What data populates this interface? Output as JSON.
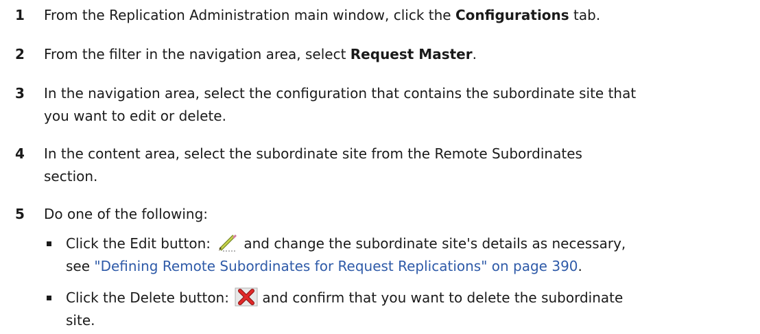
{
  "steps": [
    {
      "number": "1",
      "pre": "From the Replication Administration main window, click the ",
      "bold": "Configurations",
      "post": " tab."
    },
    {
      "number": "2",
      "pre": "From the filter in the navigation area, select ",
      "bold": "Request Master",
      "post": "."
    },
    {
      "number": "3",
      "line1": "In the navigation area, select the configuration that contains the subordinate site that",
      "line2": "you want to edit or delete."
    },
    {
      "number": "4",
      "line1": "In the content area, select the subordinate site from the Remote Subordinates",
      "line2": "section."
    },
    {
      "number": "5",
      "text": "Do one of the following:"
    }
  ],
  "bullets": [
    {
      "pre": "Click the Edit button:",
      "icon": "pencil-icon",
      "post": "and change the subordinate site's details as necessary,",
      "line2_pre": "see ",
      "link": "\"Defining Remote Subordinates for Request Replications\" on page 390",
      "line2_post": "."
    },
    {
      "pre": "Click the Delete button:",
      "icon": "red-x-icon",
      "post": "and confirm that you want to delete the subordinate",
      "line2": "site."
    }
  ],
  "colors": {
    "text": "#1a1a1a",
    "link": "#2e5aa8",
    "delete_icon": "#d42020"
  }
}
